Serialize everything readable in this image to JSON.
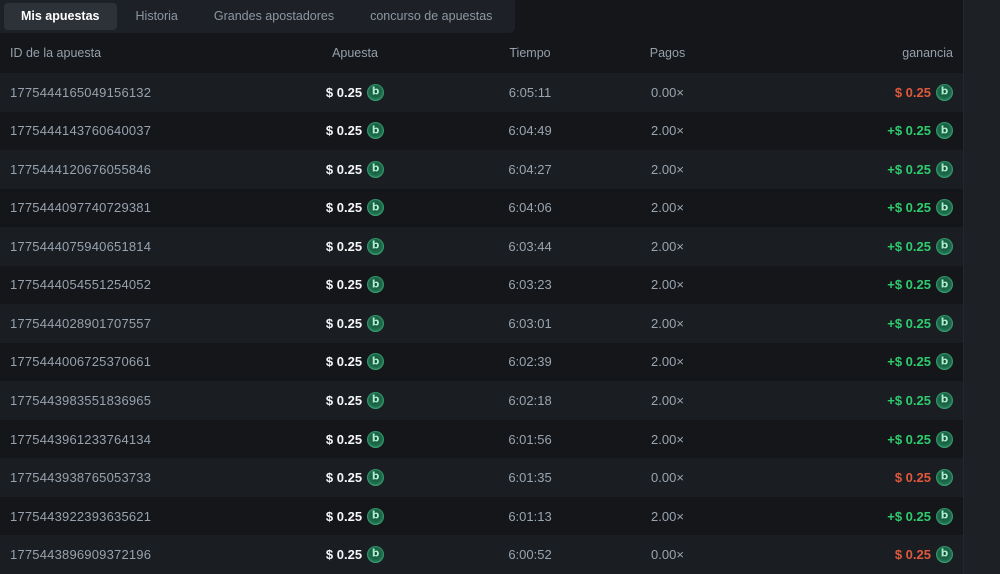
{
  "tabs": [
    {
      "label": "Mis apuestas",
      "active": true
    },
    {
      "label": "Historia",
      "active": false
    },
    {
      "label": "Grandes apostadores",
      "active": false
    },
    {
      "label": "concurso de apuestas",
      "active": false
    }
  ],
  "table": {
    "columns": [
      "ID de la apuesta",
      "Apuesta",
      "Tiempo",
      "Pagos",
      "ganancia"
    ],
    "rows": [
      {
        "id": "1775444165049156132",
        "bet": "$ 0.25",
        "time": "6:05:11",
        "payout": "0.00×",
        "profit": "$ 0.25",
        "result": "loss"
      },
      {
        "id": "1775444143760640037",
        "bet": "$ 0.25",
        "time": "6:04:49",
        "payout": "2.00×",
        "profit": "+$ 0.25",
        "result": "win"
      },
      {
        "id": "1775444120676055846",
        "bet": "$ 0.25",
        "time": "6:04:27",
        "payout": "2.00×",
        "profit": "+$ 0.25",
        "result": "win"
      },
      {
        "id": "1775444097740729381",
        "bet": "$ 0.25",
        "time": "6:04:06",
        "payout": "2.00×",
        "profit": "+$ 0.25",
        "result": "win"
      },
      {
        "id": "1775444075940651814",
        "bet": "$ 0.25",
        "time": "6:03:44",
        "payout": "2.00×",
        "profit": "+$ 0.25",
        "result": "win"
      },
      {
        "id": "1775444054551254052",
        "bet": "$ 0.25",
        "time": "6:03:23",
        "payout": "2.00×",
        "profit": "+$ 0.25",
        "result": "win"
      },
      {
        "id": "1775444028901707557",
        "bet": "$ 0.25",
        "time": "6:03:01",
        "payout": "2.00×",
        "profit": "+$ 0.25",
        "result": "win"
      },
      {
        "id": "1775444006725370661",
        "bet": "$ 0.25",
        "time": "6:02:39",
        "payout": "2.00×",
        "profit": "+$ 0.25",
        "result": "win"
      },
      {
        "id": "1775443983551836965",
        "bet": "$ 0.25",
        "time": "6:02:18",
        "payout": "2.00×",
        "profit": "+$ 0.25",
        "result": "win"
      },
      {
        "id": "1775443961233764134",
        "bet": "$ 0.25",
        "time": "6:01:56",
        "payout": "2.00×",
        "profit": "+$ 0.25",
        "result": "win"
      },
      {
        "id": "1775443938765053733",
        "bet": "$ 0.25",
        "time": "6:01:35",
        "payout": "0.00×",
        "profit": "$ 0.25",
        "result": "loss"
      },
      {
        "id": "1775443922393635621",
        "bet": "$ 0.25",
        "time": "6:01:13",
        "payout": "2.00×",
        "profit": "+$ 0.25",
        "result": "win"
      },
      {
        "id": "1775443896909372196",
        "bet": "$ 0.25",
        "time": "6:00:52",
        "payout": "0.00×",
        "profit": "$ 0.25",
        "result": "loss"
      }
    ]
  },
  "icons": {
    "coin_glyph": "b",
    "coin_name": "bcd-coin-icon"
  },
  "colors": {
    "win": "#2ecc6e",
    "loss": "#e0593c",
    "background": "#14161a",
    "row_stripe": "#1a1d22",
    "tab_active_bg": "#2d3138"
  }
}
